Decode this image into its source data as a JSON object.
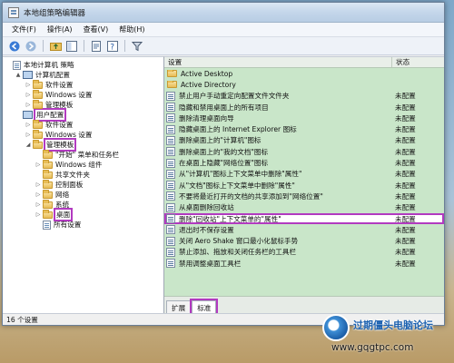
{
  "window": {
    "title": "本地组策略编辑器"
  },
  "menu": [
    "文件(F)",
    "操作(A)",
    "查看(V)",
    "帮助(H)"
  ],
  "tree": {
    "items": [
      {
        "label": "本地计算机 策略",
        "indent": 0,
        "icon": "policy-icon",
        "expander": ""
      },
      {
        "label": "计算机配置",
        "indent": 1,
        "icon": "computer-icon",
        "expander": "▲"
      },
      {
        "label": "软件设置",
        "indent": 2,
        "icon": "folder-icon",
        "expander": "▷"
      },
      {
        "label": "Windows 设置",
        "indent": 2,
        "icon": "folder-icon",
        "expander": "▷"
      },
      {
        "label": "管理模板",
        "indent": 2,
        "icon": "folder-icon",
        "expander": "▷"
      },
      {
        "label": "用户配置",
        "indent": 1,
        "icon": "user-icon",
        "expander": "",
        "highlight": true
      },
      {
        "label": "软件设置",
        "indent": 2,
        "icon": "folder-icon",
        "expander": "▷"
      },
      {
        "label": "Windows 设置",
        "indent": 2,
        "icon": "folder-icon",
        "expander": "▷"
      },
      {
        "label": "管理模板",
        "indent": 2,
        "icon": "folder-icon",
        "expander": "◢",
        "highlight": true
      },
      {
        "label": "\"开始\" 菜单和任务栏",
        "indent": 3,
        "icon": "folder-icon",
        "expander": ""
      },
      {
        "label": "Windows 组件",
        "indent": 3,
        "icon": "folder-icon",
        "expander": "▷"
      },
      {
        "label": "共享文件夹",
        "indent": 3,
        "icon": "folder-icon",
        "expander": ""
      },
      {
        "label": "控制面板",
        "indent": 3,
        "icon": "folder-icon",
        "expander": "▷"
      },
      {
        "label": "网络",
        "indent": 3,
        "icon": "folder-icon",
        "expander": "▷"
      },
      {
        "label": "系统",
        "indent": 3,
        "icon": "folder-icon",
        "expander": "▷"
      },
      {
        "label": "桌面",
        "indent": 3,
        "icon": "folder-icon",
        "expander": "▷",
        "highlight": true
      },
      {
        "label": "所有设置",
        "indent": 3,
        "icon": "doc-icon",
        "expander": ""
      }
    ]
  },
  "list": {
    "header_setting": "设置",
    "header_state": "状态",
    "rows": [
      {
        "name": "Active Desktop",
        "state": "",
        "icon": "folder-icon"
      },
      {
        "name": "Active Directory",
        "state": "",
        "icon": "folder-icon"
      },
      {
        "name": "禁止用户手动重定向配置文件文件夹",
        "state": "未配置",
        "icon": "setting-icon"
      },
      {
        "name": "隐藏和禁用桌面上的所有项目",
        "state": "未配置",
        "icon": "setting-icon"
      },
      {
        "name": "删除清理桌面向导",
        "state": "未配置",
        "icon": "setting-icon"
      },
      {
        "name": "隐藏桌面上的 Internet Explorer 图标",
        "state": "未配置",
        "icon": "setting-icon"
      },
      {
        "name": "删除桌面上的\"计算机\"图标",
        "state": "未配置",
        "icon": "setting-icon"
      },
      {
        "name": "删除桌面上的\"我的文档\"图标",
        "state": "未配置",
        "icon": "setting-icon"
      },
      {
        "name": "在桌面上隐藏\"网络位置\"图标",
        "state": "未配置",
        "icon": "setting-icon"
      },
      {
        "name": "从\"计算机\"图标上下文菜单中删除\"属性\"",
        "state": "未配置",
        "icon": "setting-icon"
      },
      {
        "name": "从\"文档\"图标上下文菜单中删除\"属性\"",
        "state": "未配置",
        "icon": "setting-icon"
      },
      {
        "name": "不要将最近打开的文档的共享添加到\"网络位置\"",
        "state": "未配置",
        "icon": "setting-icon"
      },
      {
        "name": "从桌面删除回收站",
        "state": "未配置",
        "icon": "setting-icon"
      },
      {
        "name": "删除\"回收站\"上下文菜单的\"属性\"",
        "state": "未配置",
        "icon": "setting-icon",
        "highlight": true
      },
      {
        "name": "退出时不保存设置",
        "state": "未配置",
        "icon": "setting-icon"
      },
      {
        "name": "关闭 Aero Shake 窗口最小化鼠标手势",
        "state": "未配置",
        "icon": "setting-icon"
      },
      {
        "name": "禁止添加、拖放和关闭任务栏的工具栏",
        "state": "未配置",
        "icon": "setting-icon"
      },
      {
        "name": "禁用调整桌面工具栏",
        "state": "未配置",
        "icon": "setting-icon"
      }
    ]
  },
  "tabs": [
    {
      "label": "扩展",
      "active": false
    },
    {
      "label": "标准",
      "active": true
    }
  ],
  "status": {
    "text": "16 个设置"
  },
  "watermark": {
    "title": "过期僵头电脑论坛",
    "url": "www.gqgtpc.com"
  }
}
